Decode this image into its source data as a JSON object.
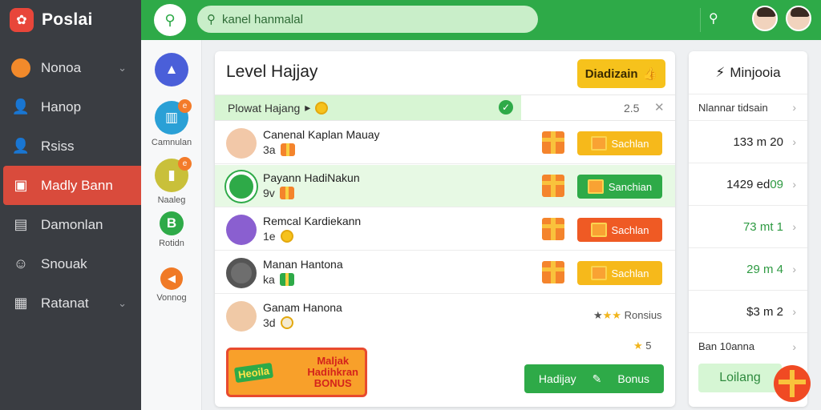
{
  "app": {
    "brand": "Poslai"
  },
  "sidebar": {
    "items": [
      {
        "label": "Nonoa",
        "icon": "face-icon",
        "chevron": true
      },
      {
        "label": "Hanop",
        "icon": "user-icon",
        "chevron": false
      },
      {
        "label": "Rsiss",
        "icon": "person-icon",
        "chevron": false
      },
      {
        "label": "Madly Bann",
        "icon": "bag-icon",
        "chevron": false,
        "active": true
      },
      {
        "label": "Damonlan",
        "icon": "calendar-icon",
        "chevron": false
      },
      {
        "label": "Snouak",
        "icon": "chat-icon",
        "chevron": false
      },
      {
        "label": "Ratanat",
        "icon": "list-icon",
        "chevron": true
      }
    ]
  },
  "topbar": {
    "search_placeholder": "kanel hanmalal"
  },
  "rail": {
    "items": [
      {
        "label": "",
        "color": "#4a5fd9"
      },
      {
        "label": "Camnulan",
        "color": "#2aa0d6",
        "badge": "e"
      },
      {
        "label": "Naaleg",
        "color": "#c9c03a",
        "badge": "e"
      },
      {
        "label": "Rotidn",
        "color": "#2eaa48",
        "glyph": "B"
      },
      {
        "label": "Vonnog",
        "color": "#f07a26"
      }
    ]
  },
  "main": {
    "title": "Level Hajjay",
    "header_button": "Diadizain",
    "filter": {
      "label": "Plowat Hajang",
      "count": "2.5"
    },
    "rows": [
      {
        "name": "Canenal  Kaplan Mauay",
        "level": "3a",
        "button": "Sachlan",
        "color": "yellow"
      },
      {
        "name": "Payann  HadiNakun",
        "level": "9v",
        "button": "Sanchian",
        "color": "green"
      },
      {
        "name": "Remcal  Kardiekann",
        "level": "1e",
        "button": "Sachlan",
        "color": "red"
      },
      {
        "name": "Manan  Hantona",
        "level": "ka",
        "button": "Sachlan",
        "color": "yellow"
      },
      {
        "name": "Ganam  Hanona",
        "level": "3d",
        "extra": "Ronsius"
      }
    ],
    "footer": {
      "promo_tag": "Heoila",
      "promo_text": [
        "Maljak",
        "Hadihkran",
        "BONUS"
      ],
      "star_count": "5",
      "bonus_button_left": "Hadijay",
      "bonus_button_right": "Bonus"
    }
  },
  "right_panel": {
    "title": "Minjooia",
    "rows": [
      {
        "value": "Nlannar tidsain",
        "style": "small"
      },
      {
        "value": "133 m 20",
        "style": "normal"
      },
      {
        "value": "1429 ed",
        "suffix": "09",
        "style": "normal"
      },
      {
        "value": "73 mt 1",
        "style": "green"
      },
      {
        "value": "29 m 4",
        "style": "green"
      },
      {
        "value": "$3 m 2",
        "style": "normal"
      },
      {
        "value": "Ban 10anna",
        "style": "small"
      }
    ],
    "footer_button": "Loilang"
  },
  "colors": {
    "green": "#2eaa48",
    "red": "#d94b3c",
    "yellow": "#f6c21c",
    "sidebar": "#3a3d42"
  }
}
